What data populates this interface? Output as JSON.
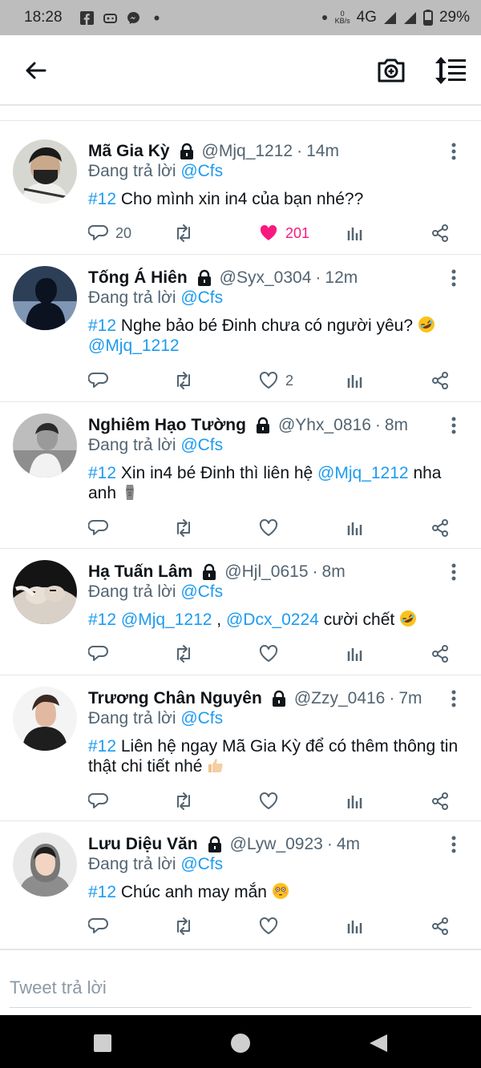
{
  "status_bar": {
    "time": "18:28",
    "network_speed_value": "0",
    "network_speed_unit": "KB/s",
    "network_type": "4G",
    "battery": "29%"
  },
  "composer": {
    "placeholder": "Tweet trả lời"
  },
  "tweets": [
    {
      "name": "Mã Gia Kỳ",
      "handle": "@Mjq_1212",
      "time": "14m",
      "replying_prefix": "Đang trả lời",
      "replying_to": "@Cfs",
      "body": [
        {
          "t": "#12",
          "link": true
        },
        {
          "t": " Cho mình xin in4 của bạn nhé??"
        }
      ],
      "reply_count": "20",
      "retweet_count": "",
      "like_count": "201",
      "liked": true,
      "avatar": "avatar-masked-boy"
    },
    {
      "name": "Tống Á Hiên",
      "handle": "@Syx_0304",
      "time": "12m",
      "replying_prefix": "Đang trả lời",
      "replying_to": "@Cfs",
      "body": [
        {
          "t": "#12",
          "link": true
        },
        {
          "t": " Nghe bảo bé Đinh chưa có người yêu? "
        },
        {
          "emoji": "rofl-emoji"
        },
        {
          "br": true
        },
        {
          "t": "@Mjq_1212",
          "link": true
        }
      ],
      "reply_count": "",
      "retweet_count": "",
      "like_count": "2",
      "liked": false,
      "avatar": "avatar-dark-silhouette"
    },
    {
      "name": "Nghiêm Hạo Tường",
      "handle": "@Yhx_0816",
      "time": "8m",
      "replying_prefix": "Đang trả lời",
      "replying_to": "@Cfs",
      "body": [
        {
          "t": "#12",
          "link": true
        },
        {
          "t": " Xin in4 bé Đinh thì liên hệ "
        },
        {
          "t": "@Mjq_1212",
          "link": true
        },
        {
          "t": " nha anh "
        },
        {
          "emoji": "moai-emoji"
        }
      ],
      "reply_count": "",
      "retweet_count": "",
      "like_count": "",
      "liked": false,
      "avatar": "avatar-grayscale-boy"
    },
    {
      "name": "Hạ Tuấn Lâm",
      "handle": "@Hjl_0615",
      "time": "8m",
      "replying_prefix": "Đang trả lời",
      "replying_to": "@Cfs",
      "body": [
        {
          "t": "#12",
          "link": true
        },
        {
          "t": " "
        },
        {
          "t": "@Mjq_1212",
          "link": true
        },
        {
          "t": " , "
        },
        {
          "t": "@Dcx_0224",
          "link": true
        },
        {
          "t": " cười chết "
        },
        {
          "emoji": "rofl-emoji"
        }
      ],
      "reply_count": "",
      "retweet_count": "",
      "like_count": "",
      "liked": false,
      "avatar": "avatar-two-faces"
    },
    {
      "name": "Trương Chân Nguyên",
      "handle": "@Zzy_0416",
      "time": "7m",
      "replying_prefix": "Đang trả lời",
      "replying_to": "@Cfs",
      "body": [
        {
          "t": "#12",
          "link": true
        },
        {
          "t": " Liên hệ ngay Mã Gia Kỳ để có thêm thông tin thật chi tiết nhé "
        },
        {
          "emoji": "thumbs-up-emoji"
        }
      ],
      "reply_count": "",
      "retweet_count": "",
      "like_count": "",
      "liked": false,
      "avatar": "avatar-boy-black-shirt"
    },
    {
      "name": "Lưu Diệu Văn",
      "handle": "@Lyw_0923",
      "time": "4m",
      "replying_prefix": "Đang trả lời",
      "replying_to": "@Cfs",
      "body": [
        {
          "t": "#12",
          "link": true
        },
        {
          "t": " Chúc anh may mắn "
        },
        {
          "emoji": "flushed-emoji"
        }
      ],
      "reply_count": "",
      "retweet_count": "",
      "like_count": "",
      "liked": false,
      "avatar": "avatar-boy-hood"
    }
  ],
  "colors": {
    "link": "#1d9bf0",
    "secondary_text": "#536471",
    "like": "#f91880",
    "status_bar_bg": "#bdbdbd"
  },
  "icons": {
    "app_bar": [
      "back-arrow-icon",
      "camera-plus-icon",
      "sort-icon"
    ],
    "actions": [
      "reply-icon",
      "retweet-icon",
      "like-icon",
      "analytics-icon",
      "share-icon"
    ],
    "nav": [
      "recents-icon",
      "home-icon",
      "back-icon"
    ]
  }
}
